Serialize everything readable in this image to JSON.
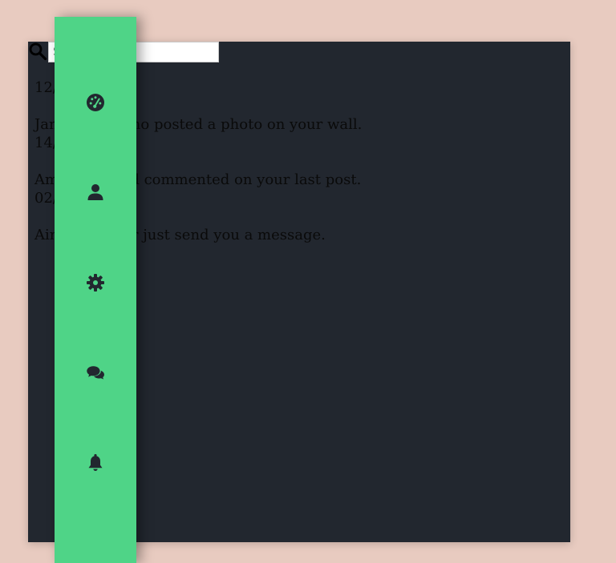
{
  "search": {
    "placeholder": "Search"
  },
  "notifications": [
    {
      "date": "12/12/2022",
      "text": ""
    },
    {
      "date": "14/12/2022",
      "text": "Jane Ocampano posted a photo on your wall."
    },
    {
      "date": "02/01/2023",
      "text": "Amanda Wood commented on your last post."
    },
    {
      "date": "",
      "text": "Ainhoa Alister just send you a message."
    }
  ],
  "sidebar": {
    "items": [
      {
        "icon": "dashboard-icon"
      },
      {
        "icon": "user-icon"
      },
      {
        "icon": "gear-icon"
      },
      {
        "icon": "chat-icon"
      },
      {
        "icon": "bell-icon"
      }
    ]
  },
  "colors": {
    "background": "#e8cbc0",
    "panel": "#22272f",
    "sidebar": "#4fd487",
    "icon": "#22272f"
  }
}
